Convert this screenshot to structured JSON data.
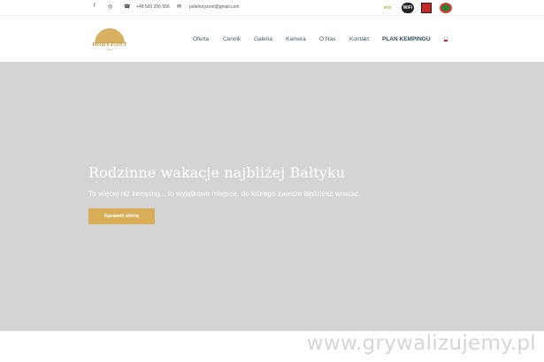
{
  "topbar": {
    "facebook_icon": "f",
    "instagram_icon": "◎",
    "phone_icon": "☎",
    "phone": "+48 500 256 556",
    "email_icon": "✉",
    "email": "polehoryzont@gmail.com",
    "badges": {
      "eco_label": "eco",
      "wifi_label": "WiFi",
      "media_label": "",
      "circle_label": ""
    }
  },
  "header": {
    "logo_text": "HORYZONT",
    "logo_sub": "camp",
    "nav": [
      {
        "label": "Oferta"
      },
      {
        "label": "Cennik"
      },
      {
        "label": "Galeria"
      },
      {
        "label": "Kamera"
      },
      {
        "label": "O Nas"
      },
      {
        "label": "Kontakt"
      },
      {
        "label": "PLAN KEMPINGU"
      }
    ]
  },
  "hero": {
    "title": "Rodzinne wakacje najbliżej Bałtyku",
    "subtitle": "To więcej niż kemping... to wyjątkowe miejsce, do którego zawsze będziesz wracać.",
    "cta_label": "Sprawdź ofertę"
  },
  "watermark": "www.grywalizujemy.pl",
  "colors": {
    "accent": "#d8ad57",
    "hero_bg": "#d4d4d4",
    "nav_text": "#3a5a6a"
  }
}
